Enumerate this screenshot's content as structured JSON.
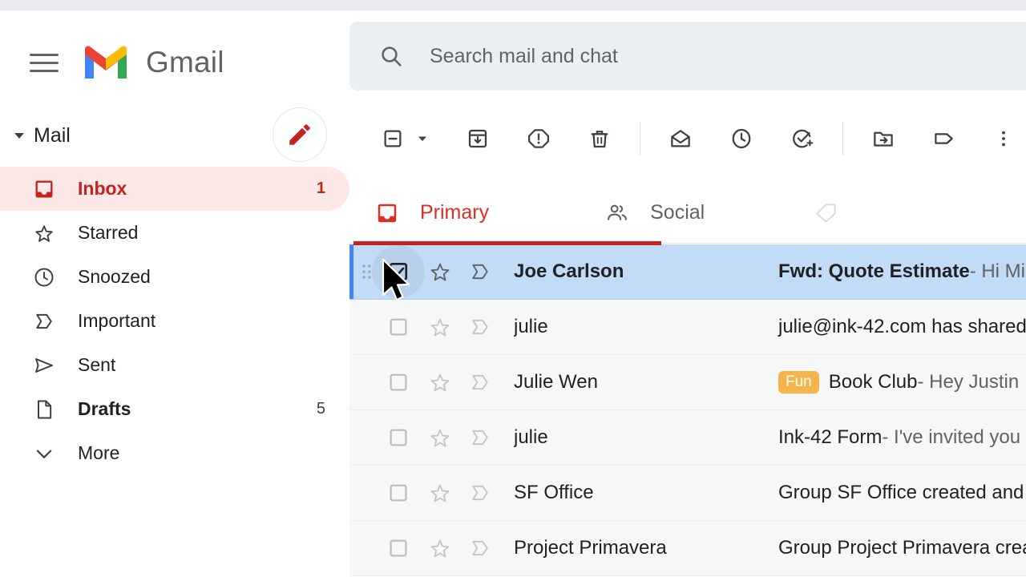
{
  "app": {
    "name": "Gmail",
    "logo_icon": "gmail-m-logo",
    "menu_icon": "hamburger-menu-icon"
  },
  "sidebar": {
    "mail_label": "Mail",
    "mail_caret_icon": "caret-down-icon",
    "compose_icon": "pencil-compose-icon",
    "items": [
      {
        "label": "Inbox",
        "count": "1",
        "icon": "inbox-icon",
        "active": true
      },
      {
        "label": "Starred",
        "count": "",
        "icon": "star-icon",
        "active": false
      },
      {
        "label": "Snoozed",
        "count": "",
        "icon": "clock-icon",
        "active": false
      },
      {
        "label": "Important",
        "count": "",
        "icon": "important-chevron-icon",
        "active": false
      },
      {
        "label": "Sent",
        "count": "",
        "icon": "send-icon",
        "active": false
      },
      {
        "label": "Drafts",
        "count": "5",
        "icon": "draft-page-icon",
        "active": false
      },
      {
        "label": "More",
        "count": "",
        "icon": "chevron-down-icon",
        "active": false
      }
    ]
  },
  "search": {
    "placeholder": "Search mail and chat",
    "icon": "search-icon",
    "value": ""
  },
  "toolbar": {
    "buttons": [
      {
        "name": "select-all-checkbox",
        "icon": "indeterminate-checkbox-icon"
      },
      {
        "name": "select-all-dropdown",
        "icon": "caret-down-icon"
      },
      {
        "name": "archive-button",
        "icon": "archive-icon"
      },
      {
        "name": "report-spam-button",
        "icon": "report-spam-icon"
      },
      {
        "name": "delete-button",
        "icon": "trash-icon"
      },
      {
        "name": "mark-unread-button",
        "icon": "open-envelope-icon"
      },
      {
        "name": "snooze-button",
        "icon": "clock-icon"
      },
      {
        "name": "add-to-tasks-button",
        "icon": "add-task-icon"
      },
      {
        "name": "move-to-button",
        "icon": "move-to-folder-icon"
      },
      {
        "name": "labels-button",
        "icon": "label-tag-icon"
      },
      {
        "name": "more-options-button",
        "icon": "more-vertical-icon"
      }
    ]
  },
  "tabs": [
    {
      "label": "Primary",
      "icon": "inbox-icon",
      "active": true
    },
    {
      "label": "Social",
      "icon": "people-icon",
      "active": false
    }
  ],
  "emails": [
    {
      "sender": "Joe Carlson",
      "subject": "Fwd: Quote Estimate",
      "snippet": " - Hi Mik",
      "badge": "",
      "selected": true,
      "checked": true,
      "starred": false
    },
    {
      "sender": "julie",
      "subject": "julie@ink-42.com has shared",
      "snippet": "",
      "badge": "",
      "selected": false,
      "checked": false,
      "starred": false
    },
    {
      "sender": "Julie Wen",
      "subject": "Book Club",
      "snippet": " - Hey Justin",
      "badge": "Fun",
      "selected": false,
      "checked": false,
      "starred": false
    },
    {
      "sender": "julie",
      "subject": "Ink-42 Form",
      "snippet": " - I've invited you",
      "badge": "",
      "selected": false,
      "checked": false,
      "starred": false
    },
    {
      "sender": "SF Office",
      "subject": "Group SF Office created and",
      "snippet": "",
      "badge": "",
      "selected": false,
      "checked": false,
      "starred": false
    },
    {
      "sender": "Project Primavera",
      "subject": "Group Project Primavera crea",
      "snippet": "",
      "badge": "",
      "selected": false,
      "checked": false,
      "starred": false
    }
  ],
  "colors": {
    "brand_red": "#c5221f",
    "tab_active_red": "#d93025",
    "selected_row_blue": "#c2dbf7",
    "selection_accent_blue": "#4285f4",
    "inbox_pill_pink": "#fce8e6",
    "badge_orange": "#f5b44a",
    "row_background": "#f6f8f8",
    "search_background": "#eaf0f1",
    "icon_gray": "#5f6368"
  }
}
